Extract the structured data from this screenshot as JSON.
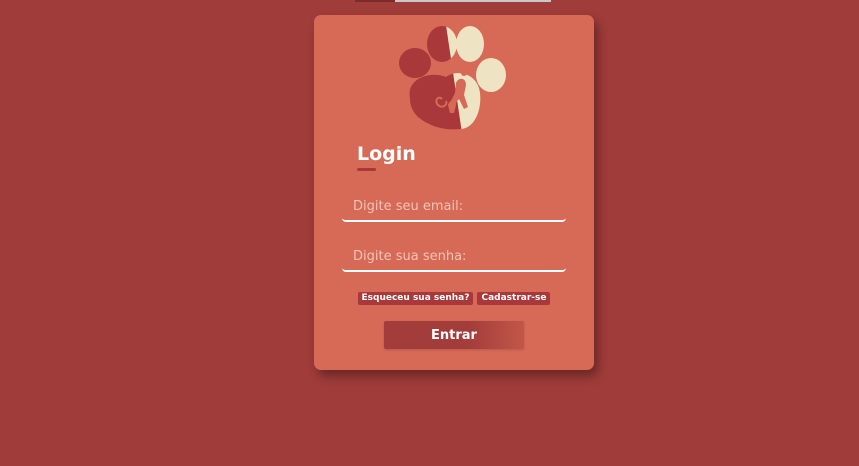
{
  "colors": {
    "background": "#a03c3a",
    "card": "#d66a57",
    "accent": "#a8383a",
    "logo_light": "#eee4c3"
  },
  "logo": {
    "icon": "paw-icon"
  },
  "login": {
    "title": "Login",
    "email_placeholder": "Digite seu email:",
    "password_placeholder": "Digite sua senha:",
    "forgot_label": "Esqueceu sua senha?",
    "register_label": "Cadastrar-se",
    "submit_label": "Entrar"
  }
}
